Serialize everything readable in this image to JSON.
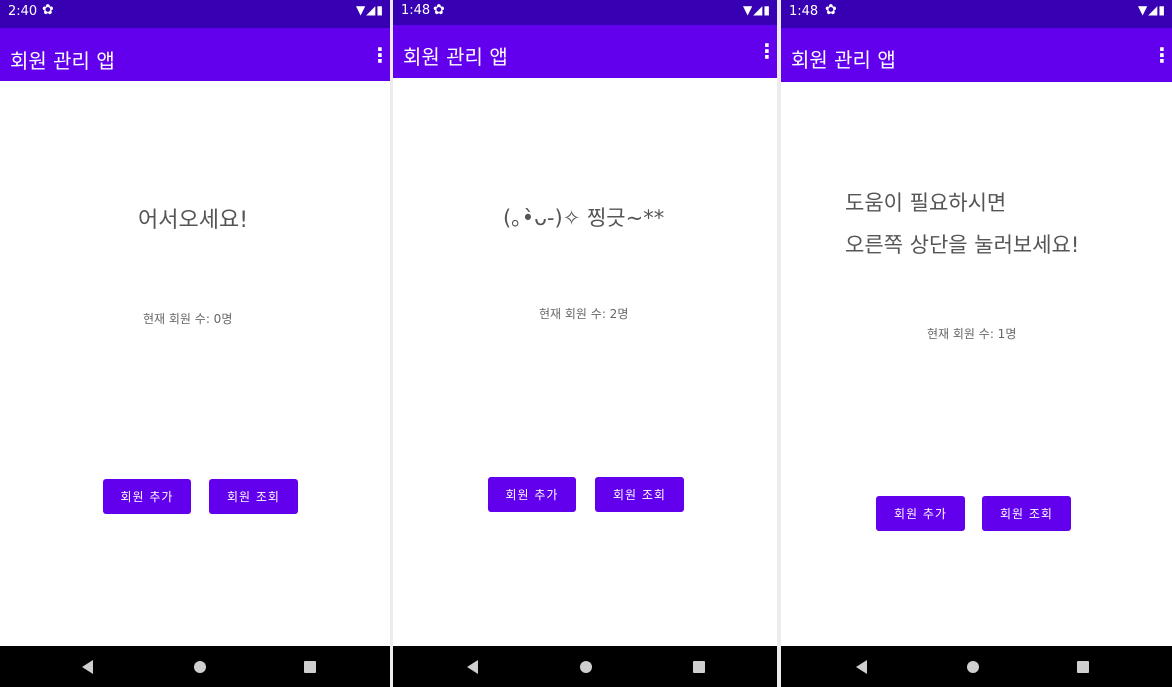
{
  "app_title": "회원 관리 앱",
  "menu_icon": "more-vert-icon",
  "settings_icon": "gear-icon",
  "nav_icons": [
    "back-triangle-icon",
    "home-circle-icon",
    "recents-square-icon"
  ],
  "colors": {
    "status_bar": "#3700b3",
    "app_bar": "#6200ee",
    "button": "#6200ee",
    "nav_bar": "#000000"
  },
  "screens": [
    {
      "time": "2:40",
      "message": "어서오세요!",
      "member_count": "현재 회원 수: 0명",
      "add_button": "회원 추가",
      "view_button": "회원 조회"
    },
    {
      "time": "1:48",
      "message": "(｡•̀ᴗ-)✧ 찡긋~**",
      "member_count": "현재 회원 수: 2명",
      "add_button": "회원 추가",
      "view_button": "회원 조회"
    },
    {
      "time": "1:48",
      "message": "도움이 필요하시면\n오른쪽 상단을 눌러보세요!",
      "member_count": "현재 회원 수: 1명",
      "add_button": "회원 추가",
      "view_button": "회원 조회"
    }
  ]
}
